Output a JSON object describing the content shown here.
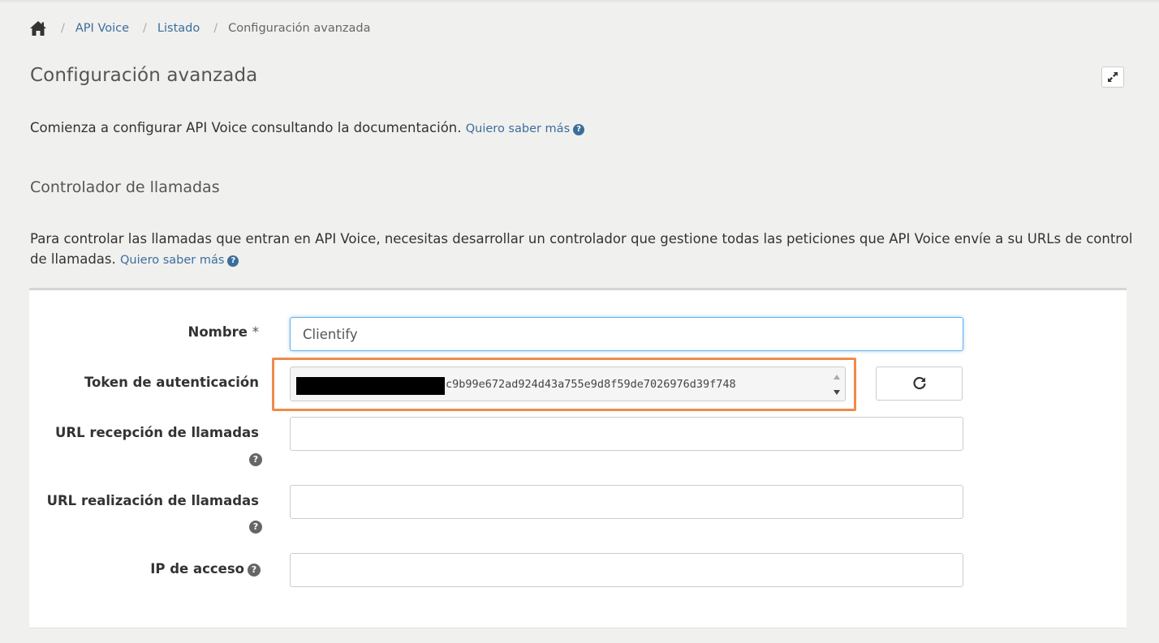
{
  "breadcrumb": {
    "home_icon": "home-icon",
    "items": [
      "API Voice",
      "Listado"
    ],
    "current": "Configuración avanzada"
  },
  "page": {
    "title": "Configuración avanzada",
    "expand_icon": "expand-icon",
    "intro": "Comienza a configurar API Voice consultando la documentación.",
    "intro_link": "Quiero saber más"
  },
  "section": {
    "title": "Controlador de llamadas",
    "description": "Para controlar las llamadas que entran en API Voice, necesitas desarrollar un controlador que gestione todas las peticiones que API Voice envíe a su URLs de control de llamadas.",
    "description_link": "Quiero saber más"
  },
  "form": {
    "nombre": {
      "label": "Nombre",
      "required": "*",
      "value": "Clientify"
    },
    "token": {
      "label": "Token de autenticación",
      "value_visible": "c9b99e672ad924d43a755e9d8f59de7026976d39f748",
      "refresh_icon": "refresh-icon"
    },
    "url_recepcion": {
      "label": "URL recepción de llamadas",
      "value": ""
    },
    "url_realizacion": {
      "label": "URL realización de llamadas",
      "value": ""
    },
    "ip_acceso": {
      "label": "IP de acceso",
      "value": ""
    }
  },
  "colors": {
    "link": "#3b6e9b",
    "highlight": "#f08a4b",
    "focus": "#66afe9",
    "background": "#f0f0ef"
  }
}
